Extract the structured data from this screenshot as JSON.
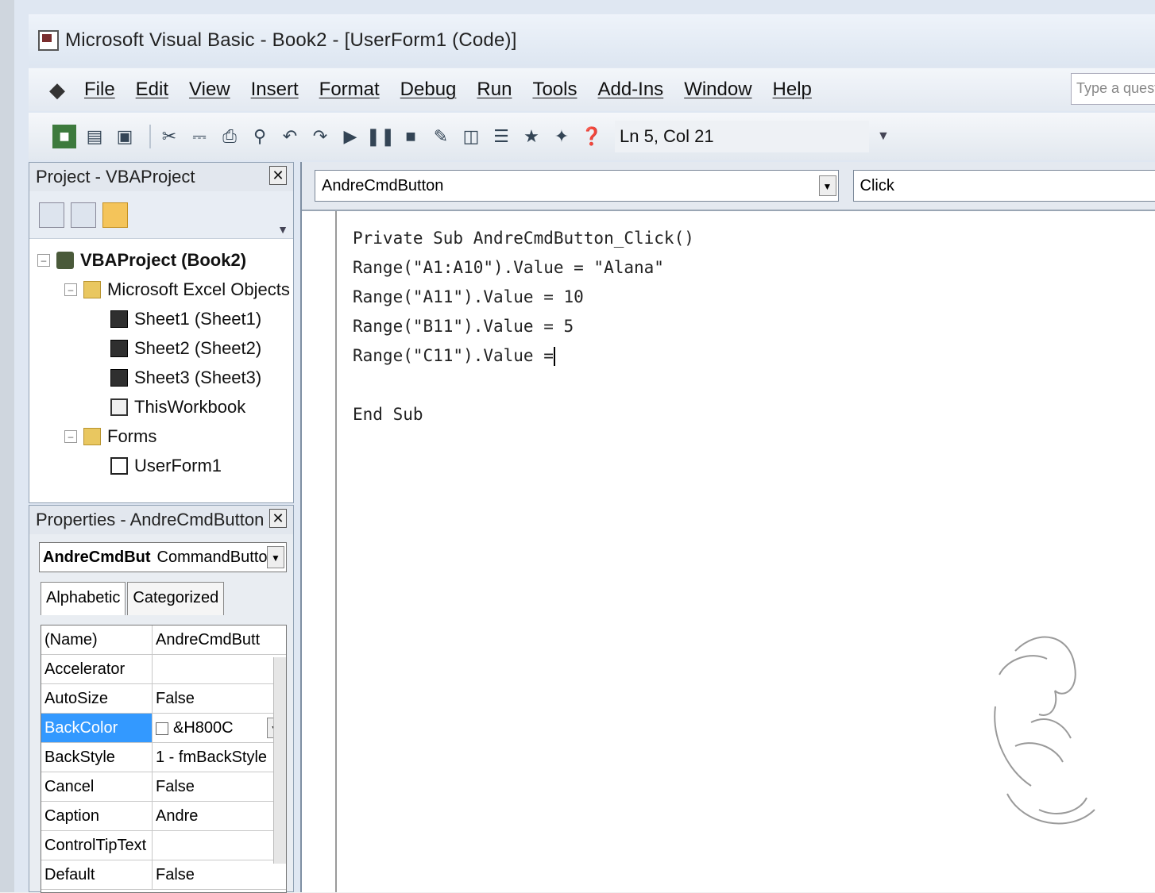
{
  "window": {
    "title": "Microsoft Visual Basic - Book2 - [UserForm1 (Code)]"
  },
  "menu": {
    "items": [
      "File",
      "Edit",
      "View",
      "Insert",
      "Format",
      "Debug",
      "Run",
      "Tools",
      "Add-Ins",
      "Window",
      "Help"
    ],
    "help_search_placeholder": "Type a question"
  },
  "toolbar": {
    "cursor_position": "Ln 5, Col 21"
  },
  "project": {
    "title": "Project - VBAProject",
    "tree": [
      {
        "label": "VBAProject (Book2)",
        "level": 0,
        "icon": "vba-project-icon"
      },
      {
        "label": "Microsoft Excel Objects",
        "level": 1,
        "icon": "folder-icon"
      },
      {
        "label": "Sheet1 (Sheet1)",
        "level": 2,
        "icon": "worksheet-icon"
      },
      {
        "label": "Sheet2 (Sheet2)",
        "level": 2,
        "icon": "worksheet-icon"
      },
      {
        "label": "Sheet3 (Sheet3)",
        "level": 2,
        "icon": "worksheet-icon"
      },
      {
        "label": "ThisWorkbook",
        "level": 2,
        "icon": "workbook-icon"
      },
      {
        "label": "Forms",
        "level": 1,
        "icon": "folder-icon"
      },
      {
        "label": "UserForm1",
        "level": 2,
        "icon": "userform-icon"
      }
    ]
  },
  "properties": {
    "title": "Properties - AndreCmdButton",
    "object_name": "AndreCmdBut",
    "object_type": "CommandButto",
    "tabs": [
      "Alphabetic",
      "Categorized"
    ],
    "rows": [
      {
        "name": "(Name)",
        "value": "AndreCmdButt"
      },
      {
        "name": "Accelerator",
        "value": ""
      },
      {
        "name": "AutoSize",
        "value": "False"
      },
      {
        "name": "BackColor",
        "value": "&H800C"
      },
      {
        "name": "BackStyle",
        "value": "1 - fmBackStyle"
      },
      {
        "name": "Cancel",
        "value": "False"
      },
      {
        "name": "Caption",
        "value": "Andre"
      },
      {
        "name": "ControlTipText",
        "value": ""
      },
      {
        "name": "Default",
        "value": "False"
      }
    ]
  },
  "code": {
    "object_combo": "AndreCmdButton",
    "procedure_combo": "Click",
    "lines": [
      "Private Sub AndreCmdButton_Click()",
      "Range(\"A1:A10\").Value = \"Alana\"",
      "Range(\"A11\").Value = 10",
      "Range(\"B11\").Value = 5",
      "Range(\"C11\").Value =",
      "",
      "End Sub"
    ]
  }
}
